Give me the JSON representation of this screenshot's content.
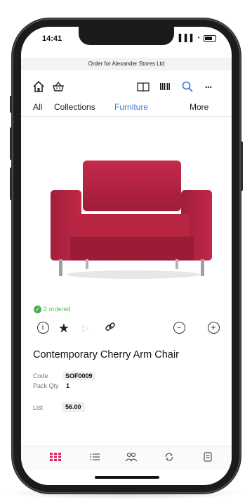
{
  "status_bar": {
    "time": "14:41",
    "signal": "▐▐▐",
    "wifi": "◔"
  },
  "header": {
    "order_title": "Order for Alexander Stores Ltd"
  },
  "toolbar": {
    "icons": [
      "home-icon",
      "basket-icon",
      "catalog-book-icon",
      "barcode-icon",
      "search-icon",
      "more-icon"
    ],
    "more_label": "•••"
  },
  "tabs": [
    {
      "label": "All"
    },
    {
      "label": "Collections"
    },
    {
      "label": "Furniture",
      "active": true
    },
    {
      "label": "More"
    }
  ],
  "product": {
    "ordered_text": "2 ordered",
    "name": "Contemporary Cherry Arm Chair",
    "code_label": "Code",
    "code_value": "SOF0009",
    "pack_qty_label": "Pack Qty",
    "pack_qty_value": "1",
    "list_label": "List",
    "list_value": "56.00",
    "color": "#b0223f"
  },
  "bottom_nav": {
    "icons": [
      "grid-icon",
      "list-icon",
      "customers-icon",
      "sync-icon",
      "orders-icon"
    ],
    "active_color": "#e0245e"
  },
  "accent": "#3d73d6"
}
